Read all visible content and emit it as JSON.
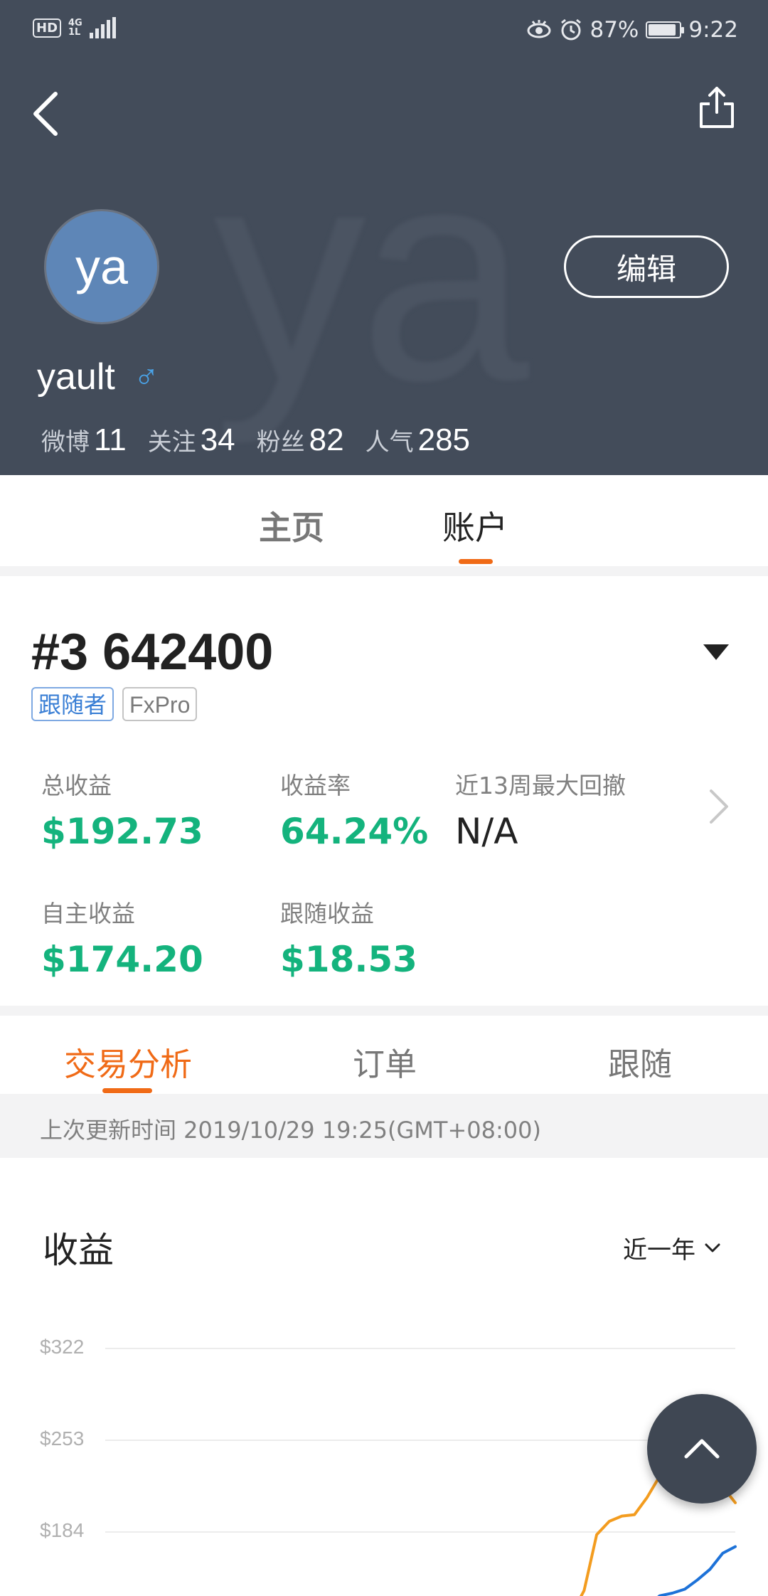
{
  "status_bar": {
    "hd": "HD",
    "net_top": "4G",
    "net_bottom": "1L",
    "battery": "87%",
    "time": "9:22"
  },
  "profile": {
    "watermark": "ya",
    "avatar_text": "ya",
    "edit_label": "编辑",
    "username": "yault",
    "gender_symbol": "♂",
    "stats": [
      {
        "label": "微博",
        "value": "11"
      },
      {
        "label": "关注",
        "value": "34"
      },
      {
        "label": "粉丝",
        "value": "82"
      },
      {
        "label": "人气",
        "value": "285"
      }
    ]
  },
  "top_tabs": [
    {
      "label": "主页"
    },
    {
      "label": "账户"
    }
  ],
  "account": {
    "number": "#3 642400",
    "badges": [
      "跟随者",
      "FxPro"
    ],
    "metrics": [
      {
        "label": "总收益",
        "value": "$192.73"
      },
      {
        "label": "收益率",
        "value": "64.24%"
      },
      {
        "label": "近13周最大回撤",
        "value": "N/A"
      },
      {
        "label": "自主收益",
        "value": "$174.20"
      },
      {
        "label": "跟随收益",
        "value": "$18.53"
      }
    ]
  },
  "analysis_tabs": [
    {
      "label": "交易分析"
    },
    {
      "label": "订单"
    },
    {
      "label": "跟随"
    }
  ],
  "update_text": "上次更新时间 2019/10/29 19:25(GMT+08:00)",
  "chart_section": {
    "title": "收益",
    "period": "近一年"
  },
  "chart_data": {
    "type": "line",
    "y_ticks": [
      "$322",
      "$253",
      "$184"
    ],
    "ylim": [
      115,
      322
    ],
    "x": [
      0.7,
      0.72,
      0.74,
      0.76,
      0.78,
      0.8,
      0.82,
      0.84,
      0.86,
      0.88,
      0.9,
      0.92,
      0.94,
      0.96,
      0.98,
      1.0
    ],
    "series": [
      {
        "color": "#f39c1f",
        "values": [
          null,
          118,
          122,
          140,
          182,
          192,
          196,
          197,
          210,
          226,
          230,
          232,
          236,
          232,
          218,
          206
        ]
      },
      {
        "color": "#1d72d8",
        "values": [
          null,
          null,
          null,
          null,
          null,
          null,
          null,
          118,
          128,
          136,
          138,
          141,
          148,
          156,
          168,
          173
        ]
      }
    ],
    "grid": true
  }
}
